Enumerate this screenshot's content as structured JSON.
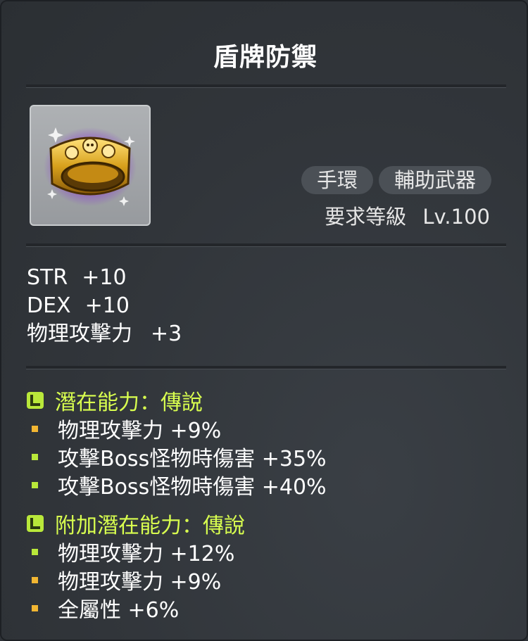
{
  "item": {
    "name": "盾牌防禦",
    "categories": [
      "手環",
      "輔助武器"
    ],
    "required_level_label": "要求等級",
    "required_level_value": "Lv.100",
    "icon": "golden-skull-bracelet-icon"
  },
  "stats": [
    {
      "name": "STR",
      "value": "+10"
    },
    {
      "name": "DEX",
      "value": "+10"
    },
    {
      "name": "物理攻擊力",
      "value": "+3"
    }
  ],
  "potential": {
    "grade_label": "L",
    "title": "潛在能力：傳說",
    "lines": [
      {
        "text": "物理攻擊力 +9%",
        "bullet_color": "#f2b632"
      },
      {
        "text": "攻擊Boss怪物時傷害 +35%",
        "bullet_color": "#b9e83a"
      },
      {
        "text": "攻擊Boss怪物時傷害 +40%",
        "bullet_color": "#b9e83a"
      }
    ]
  },
  "additional_potential": {
    "grade_label": "L",
    "title": "附加潛在能力：傳說",
    "lines": [
      {
        "text": "物理攻擊力 +12%",
        "bullet_color": "#b9e83a"
      },
      {
        "text": "物理攻擊力 +9%",
        "bullet_color": "#f2b632"
      },
      {
        "text": "全屬性 +6%",
        "bullet_color": "#f2b632"
      }
    ]
  },
  "colors": {
    "legendary": "#d9ff4f",
    "background": "#31353a"
  }
}
